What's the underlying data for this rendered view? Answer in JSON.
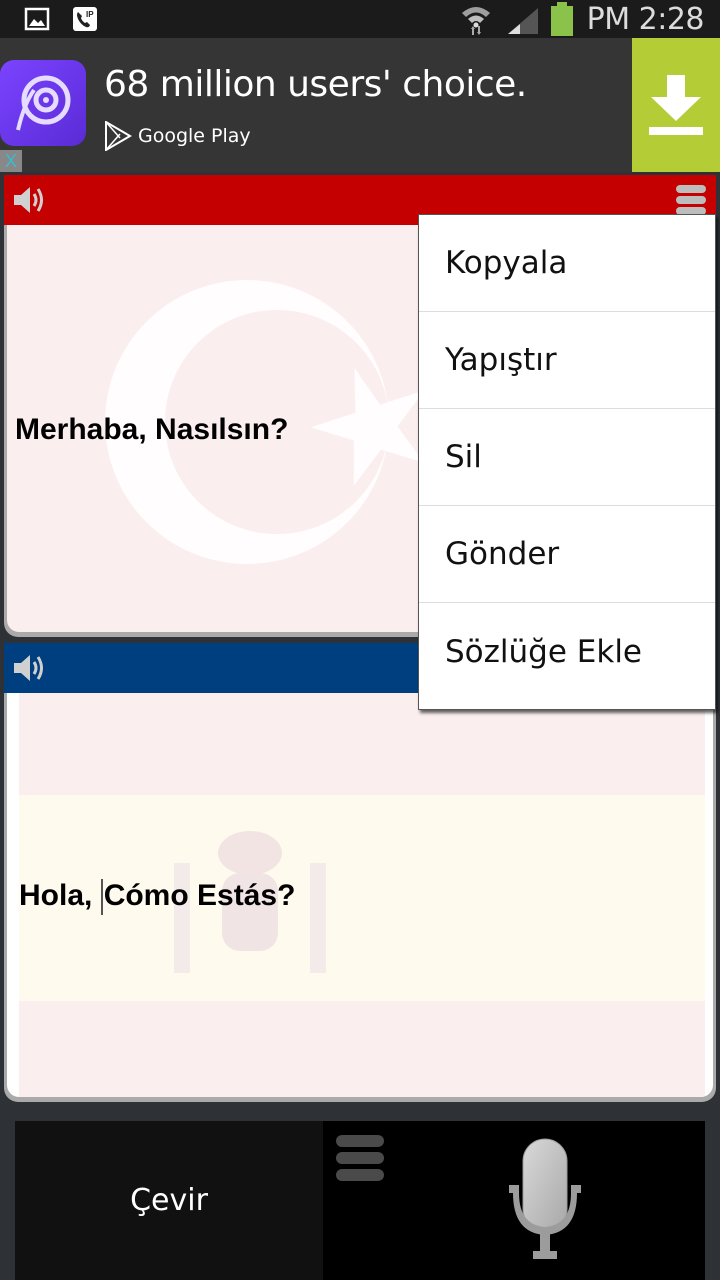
{
  "status_bar": {
    "time": "PM 2:28",
    "left_icons": [
      "gallery-icon",
      "ip-call-icon"
    ],
    "right_icons": [
      "wifi-icon",
      "signal-icon",
      "battery-icon"
    ],
    "battery_color": "#8bc34a"
  },
  "ad": {
    "title": "68 million users' choice.",
    "store_label": "Google Play",
    "download_color": "#b4cc35",
    "close_label": "X"
  },
  "source_panel": {
    "language_flag": "Turkey",
    "header_color": "#c40000",
    "text": "Merhaba, Nasılsın?"
  },
  "target_panel": {
    "language_flag": "Spain",
    "header_color": "#003f7f",
    "text_before_cursor": "Hola, ",
    "text_after_cursor": "Cómo Estás?"
  },
  "popup_menu": {
    "items": [
      {
        "label": "Kopyala"
      },
      {
        "label": "Yapıştır"
      },
      {
        "label": "Sil"
      },
      {
        "label": "Gönder"
      },
      {
        "label": "Sözlüğe Ekle"
      }
    ]
  },
  "bottom_bar": {
    "translate_label": "Çevir"
  }
}
